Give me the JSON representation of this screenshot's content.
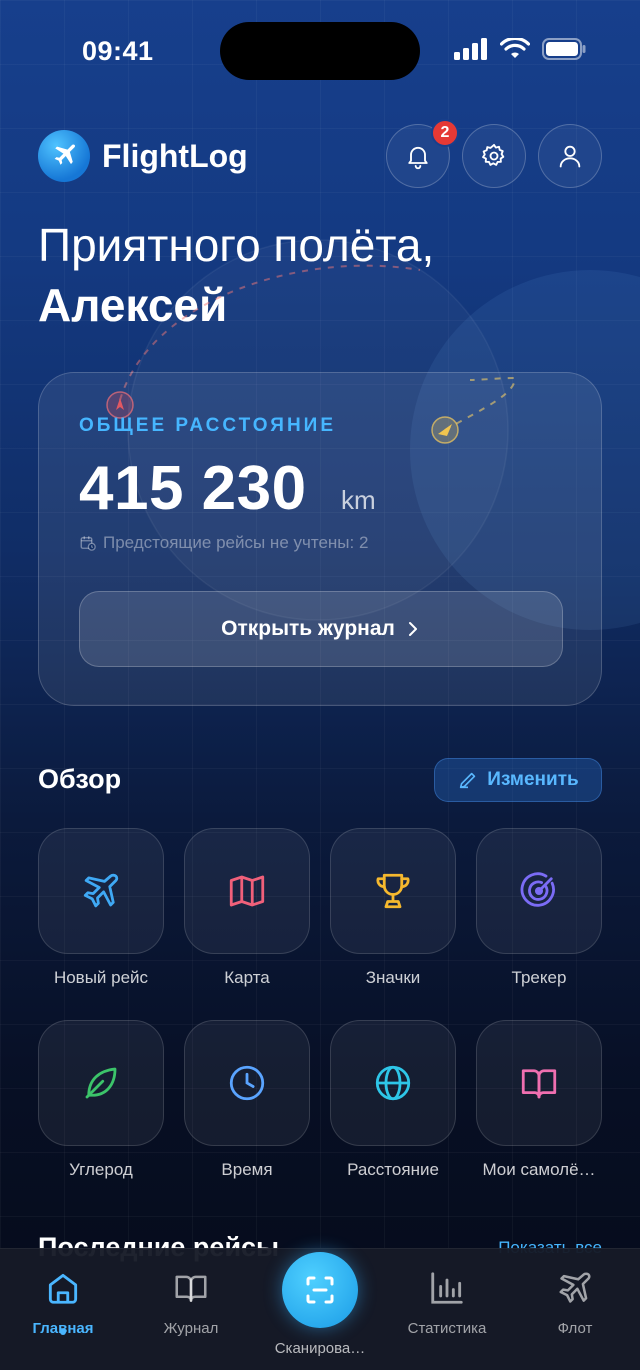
{
  "status_bar": {
    "time": "09:41"
  },
  "header": {
    "app_title": "FlightLog",
    "notification_count": "2"
  },
  "greeting": {
    "line1": "Приятного полёта,",
    "name": "Алексей"
  },
  "distance_card": {
    "label": "ОБЩЕЕ РАССТОЯНИЕ",
    "value": "415 230",
    "unit": "km",
    "note": "Предстоящие рейсы не учтены: 2",
    "button_label": "Открыть журнал"
  },
  "overview": {
    "title": "Обзор",
    "edit_label": "Изменить",
    "tiles": [
      {
        "label": "Новый рейс",
        "icon": "plane-icon",
        "color": "#3fa9f5"
      },
      {
        "label": "Карта",
        "icon": "map-icon",
        "color": "#f0607a"
      },
      {
        "label": "Значки",
        "icon": "trophy-icon",
        "color": "#f5b82e"
      },
      {
        "label": "Трекер",
        "icon": "radar-icon",
        "color": "#7b6cf6"
      },
      {
        "label": "Углерод",
        "icon": "leaf-icon",
        "color": "#3cc46a"
      },
      {
        "label": "Время",
        "icon": "clock-icon",
        "color": "#5aa4ff"
      },
      {
        "label": "Расстояние",
        "icon": "globe-icon",
        "color": "#2ec6e8"
      },
      {
        "label": "Мои самолё…",
        "icon": "book-icon",
        "color": "#f06fb0"
      }
    ]
  },
  "recent": {
    "title": "Последние рейсы",
    "link": "Показать все"
  },
  "tab_bar": {
    "tabs": [
      {
        "label": "Главная",
        "icon": "home-icon"
      },
      {
        "label": "Журнал",
        "icon": "book-icon"
      },
      {
        "label": "Сканирова…",
        "icon": "scan-icon"
      },
      {
        "label": "Статистика",
        "icon": "bar-chart-icon"
      },
      {
        "label": "Флот",
        "icon": "plane-icon"
      }
    ]
  }
}
